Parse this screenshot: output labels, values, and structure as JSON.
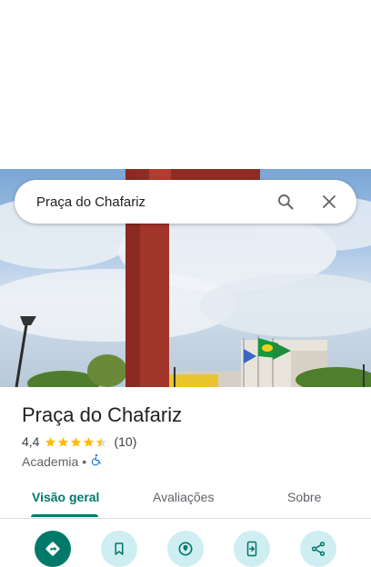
{
  "search": {
    "query": "Praça do Chafariz"
  },
  "place": {
    "name": "Praça do Chafariz",
    "rating": "4,4",
    "stars": 4.4,
    "review_count": "(10)",
    "category": "Academia",
    "separator": "•"
  },
  "tabs": [
    {
      "label": "Visão geral",
      "active": true
    },
    {
      "label": "Avaliações",
      "active": false
    },
    {
      "label": "Sobre",
      "active": false
    }
  ],
  "actions": [
    {
      "icon": "directions-icon"
    },
    {
      "icon": "bookmark-icon"
    },
    {
      "icon": "nearby-icon"
    },
    {
      "icon": "send-to-phone-icon"
    },
    {
      "icon": "share-icon"
    }
  ],
  "colors": {
    "accent": "#00796b",
    "star": "#fbbc04",
    "action_bg": "#cfeef1"
  }
}
